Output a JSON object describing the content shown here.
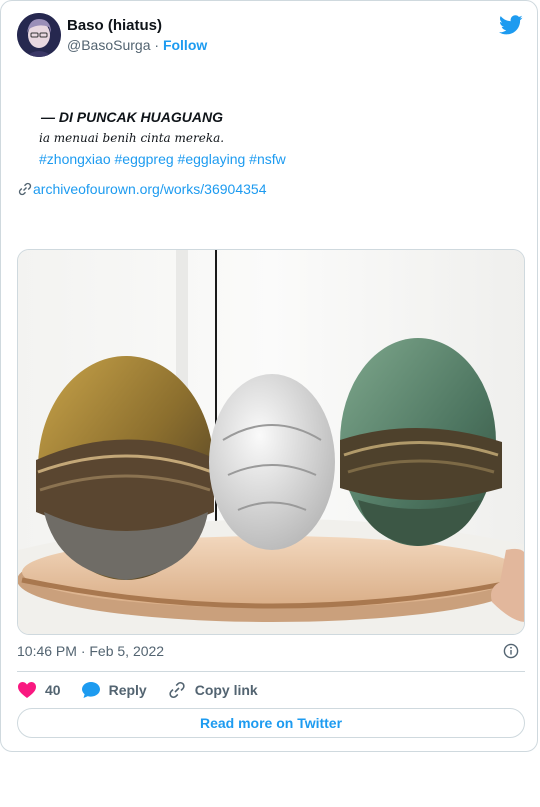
{
  "author": {
    "name": "Baso (hiatus)",
    "handle": "@BasoSurga",
    "separator": "·",
    "follow_label": "Follow"
  },
  "tweet": {
    "title_line": "— DI PUNCAK HUAGUANG",
    "subtitle_line": "ia menuai benih cinta mereka.",
    "hashtags": "#zhongxiao #eggpreg #egglaying #nsfw",
    "link_text": "archiveofourown.org/works/36904354",
    "timestamp": "10:46 PM · Feb 5, 2022"
  },
  "actions": {
    "like_count": "40",
    "reply_label": "Reply",
    "copy_label": "Copy link"
  },
  "read_more_label": "Read more on Twitter",
  "colors": {
    "accent": "#1d9bf0",
    "like": "#f91880",
    "reply": "#1d9bf0"
  },
  "icons": [
    "twitter-bird-icon",
    "link-icon",
    "info-icon",
    "heart-icon",
    "reply-bubble-icon",
    "copy-link-icon"
  ]
}
